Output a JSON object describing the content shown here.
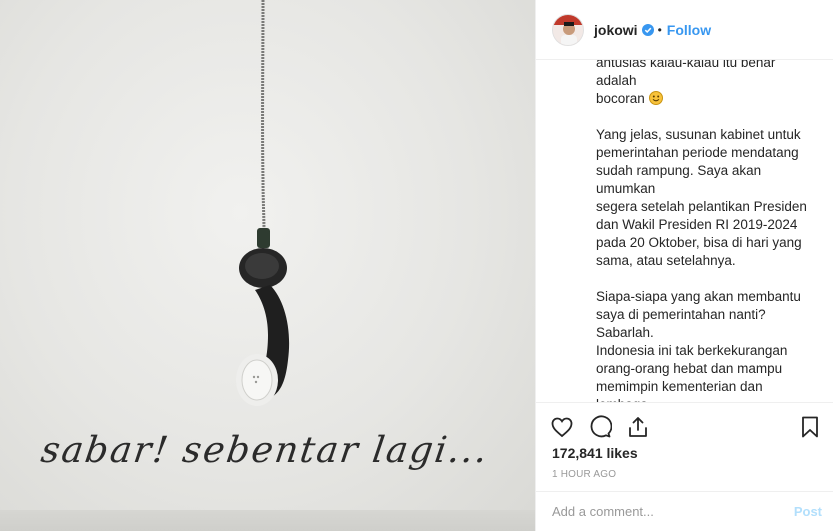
{
  "photo": {
    "caption_art": "sabar! sebentar lagi..."
  },
  "header": {
    "username": "jokowi",
    "separator": "•",
    "follow_label": "Follow"
  },
  "comment": {
    "text_part1": "antusias kalau-kalau itu benar adalah\nbocoran ",
    "text_part2": "\n\nYang jelas, susunan kabinet untuk\npemerintahan periode mendatang\nsudah rampung. Saya akan umumkan\nsegera setelah pelantikan Presiden\ndan Wakil Presiden RI 2019-2024\npada 20 Oktober, bisa di hari yang\nsama, atau setelahnya.\n\nSiapa-siapa yang akan membantu\nsaya di pemerintahan nanti? Sabarlah.\nIndonesia ini tak berkekurangan\norang-orang hebat dan mampu\nmemimpin kementerian dan lembaga,\ndan bersedia untuk mengabdi kepada\nbangsa ini.\n\nMereka terserak di semua bidang\npekerjaan dan profesi: akademisi,"
  },
  "actions": {
    "likes": "172,841 likes",
    "timestamp": "1 HOUR AGO"
  },
  "add_comment": {
    "placeholder": "Add a comment...",
    "post_label": "Post"
  },
  "colors": {
    "accent": "#3897f0",
    "post_disabled": "#b2dffc",
    "muted": "#999999"
  }
}
